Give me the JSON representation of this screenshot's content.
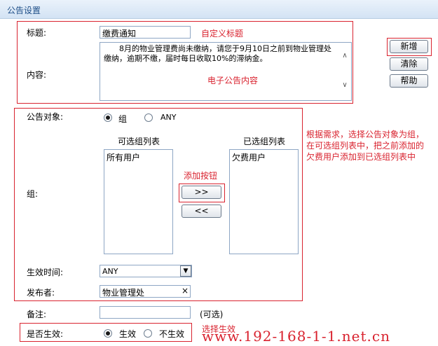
{
  "header": {
    "title": "公告设置"
  },
  "title_field": {
    "label": "标题:",
    "value": "缴费通知",
    "annotation": "自定义标题"
  },
  "content_field": {
    "label": "内容:",
    "value": "8月的物业管理费尚未缴纳，请您于9月10日之前到物业管理处缴纳，逾期不缴，届时每日收取10%的滞纳金。",
    "annotation": "电子公告内容"
  },
  "buttons": {
    "add": "新增",
    "clear": "清除",
    "help": "帮助"
  },
  "target": {
    "label": "公告对象:",
    "options": [
      {
        "label": "组",
        "selected": true
      },
      {
        "label": "ANY",
        "selected": false
      }
    ],
    "annotation": "根据需求，选择公告对象为组，在可选组列表中，把之前添加的欠费用户添加到已选组列表中"
  },
  "groups": {
    "label": "组:",
    "available_title": "可选组列表",
    "selected_title": "已选组列表",
    "available_items": [
      "所有用户"
    ],
    "selected_items": [
      "欠费用户"
    ],
    "add_btn": ">>",
    "remove_btn": "<<",
    "add_annotation": "添加按钮"
  },
  "effective_time": {
    "label": "生效时间:",
    "value": "ANY"
  },
  "publisher": {
    "label": "发布者:",
    "value": "物业管理处",
    "clear_glyph": "×"
  },
  "remark": {
    "label": "备注:",
    "value": "",
    "hint": "(可选)"
  },
  "enabled": {
    "label": "是否生效:",
    "options": [
      {
        "label": "生效",
        "selected": true
      },
      {
        "label": "不生效",
        "selected": false
      }
    ],
    "annotation": "选择生效"
  },
  "watermark": "www.192-168-1-1.net.cn",
  "colors": {
    "annotation": "#d9232f",
    "header_text": "#1f4f88",
    "border": "#8ea6c4"
  }
}
